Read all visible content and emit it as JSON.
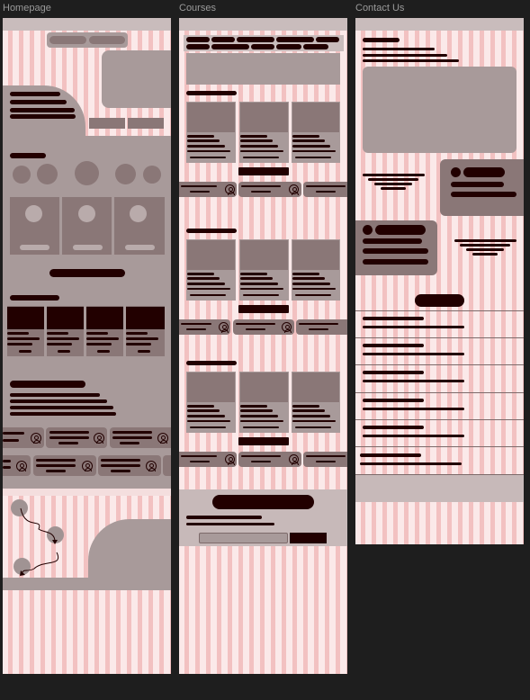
{
  "frames": {
    "homepage": {
      "label": "Homepage"
    },
    "courses": {
      "label": "Courses"
    },
    "contact": {
      "label": "Contact Us"
    }
  },
  "colors": {
    "canvas": "#1e1e1e",
    "frame_bg": "#fbe9e9",
    "grid_column": "#eca0a0",
    "placeholder": "#a89a9a",
    "placeholder_dark": "#8a7777",
    "text_block": "#220000"
  },
  "icons": [
    "user-icon",
    "arrow-icon"
  ]
}
